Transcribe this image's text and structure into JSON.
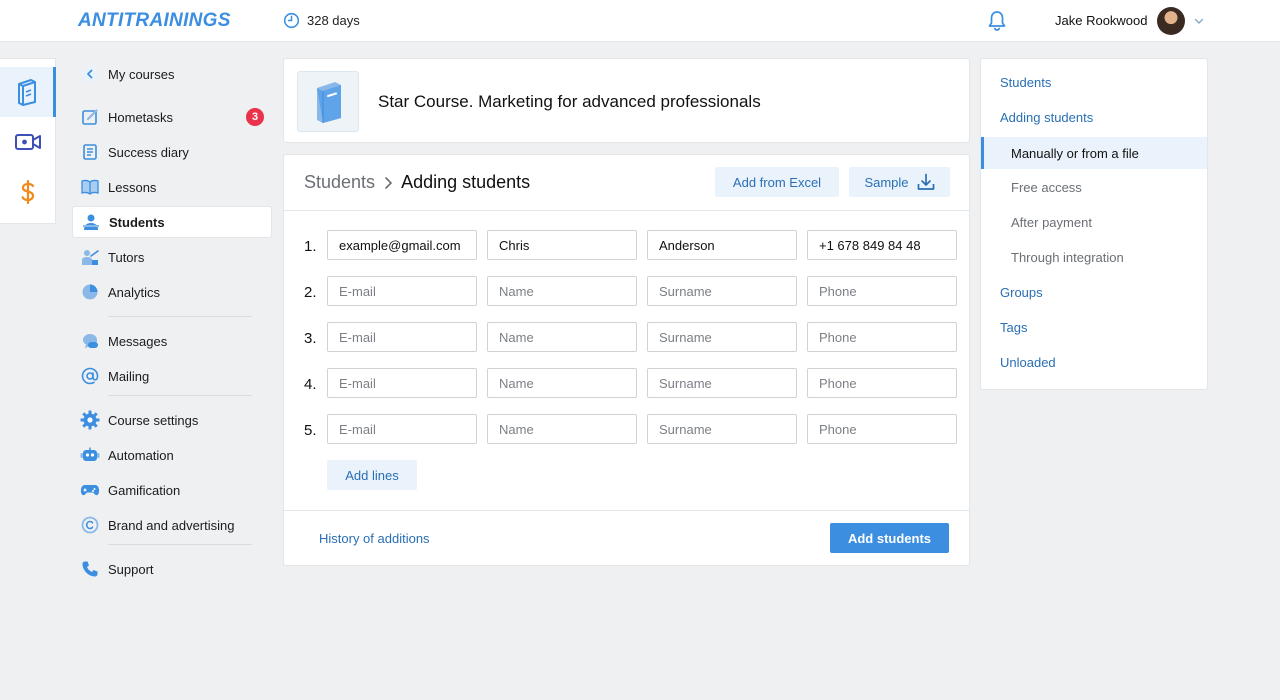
{
  "brand": {
    "logo_text": "ANTITRAININGS",
    "accent": "#3b8ee0"
  },
  "header": {
    "days_text": "328 days",
    "user_name": "Jake Rookwood"
  },
  "rail": [
    {
      "icon": "book-icon",
      "active": true
    },
    {
      "icon": "video-camera-icon",
      "active": false
    },
    {
      "icon": "dollar-icon",
      "active": false
    }
  ],
  "sidebar": {
    "back_label": "My courses",
    "items": [
      {
        "label": "Hometasks",
        "icon": "hometask-icon",
        "badge": "3"
      },
      {
        "label": "Success diary",
        "icon": "diary-icon"
      },
      {
        "label": "Lessons",
        "icon": "lessons-icon"
      },
      {
        "label": "Students",
        "icon": "students-icon",
        "active": true
      },
      {
        "label": "Tutors",
        "icon": "tutors-icon"
      },
      {
        "label": "Analytics",
        "icon": "analytics-icon"
      },
      {
        "label": "Messages",
        "icon": "messages-icon"
      },
      {
        "label": "Mailing",
        "icon": "mailing-icon"
      },
      {
        "label": "Course settings",
        "icon": "gear-icon"
      },
      {
        "label": "Automation",
        "icon": "robot-icon"
      },
      {
        "label": "Gamification",
        "icon": "gamepad-icon"
      },
      {
        "label": "Brand and advertising",
        "icon": "copyright-icon"
      },
      {
        "label": "Support",
        "icon": "phone-icon"
      }
    ]
  },
  "course": {
    "title": "Star Course. Marketing for advanced professionals"
  },
  "main": {
    "crumb_parent": "Students",
    "crumb_current": "Adding students",
    "add_from_excel_label": "Add from Excel",
    "sample_label": "Sample",
    "placeholders": {
      "email": "E-mail",
      "name": "Name",
      "surname": "Surname",
      "phone": "Phone"
    },
    "rows": [
      {
        "num": "1.",
        "email": "example@gmail.com",
        "name": "Chris",
        "surname": "Anderson",
        "phone": "+1 678 849 84 48"
      },
      {
        "num": "2.",
        "email": "",
        "name": "",
        "surname": "",
        "phone": ""
      },
      {
        "num": "3.",
        "email": "",
        "name": "",
        "surname": "",
        "phone": ""
      },
      {
        "num": "4.",
        "email": "",
        "name": "",
        "surname": "",
        "phone": ""
      },
      {
        "num": "5.",
        "email": "",
        "name": "",
        "surname": "",
        "phone": ""
      }
    ],
    "add_lines_label": "Add lines",
    "history_label": "History of additions",
    "add_students_label": "Add students"
  },
  "right_panel": {
    "items": [
      {
        "label": "Students",
        "level": 1
      },
      {
        "label": "Adding students",
        "level": 1
      },
      {
        "label": "Manually or from a file",
        "level": 2,
        "active": true
      },
      {
        "label": "Free access",
        "level": 2
      },
      {
        "label": "After payment",
        "level": 2
      },
      {
        "label": "Through integration",
        "level": 2
      },
      {
        "label": "Groups",
        "level": 1
      },
      {
        "label": "Tags",
        "level": 1
      },
      {
        "label": "Unloaded",
        "level": 1
      }
    ]
  }
}
